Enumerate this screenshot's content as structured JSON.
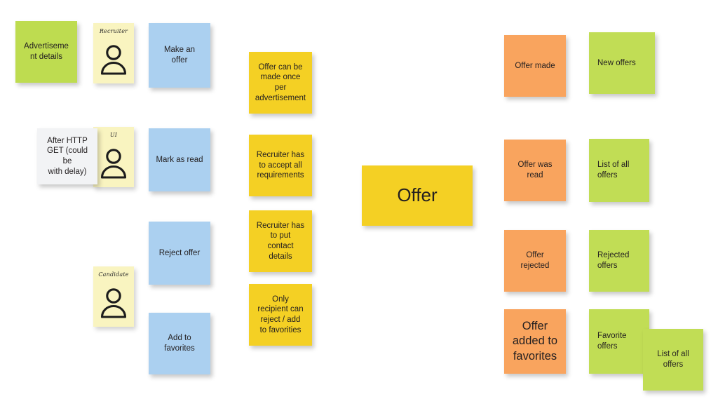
{
  "board": {
    "title": "Offer event storming board",
    "background": "#ffffff",
    "colors": {
      "green": "#c1dd55",
      "blue": "#abd0f0",
      "yellow": "#f4d024",
      "orange": "#f9a45e",
      "pale_yellow": "#f9f4c0",
      "white_note": "#f2f3f5",
      "text": "#231f20"
    }
  },
  "aggregate": {
    "label": "Offer"
  },
  "read_models_left": [
    {
      "label": "Advertiseme\nnt details"
    }
  ],
  "personas": [
    {
      "label": "Recruiter",
      "icon": "person-icon"
    },
    {
      "label": "UI",
      "icon": "person-icon"
    },
    {
      "label": "Candidate",
      "icon": "person-icon"
    }
  ],
  "annotations": [
    {
      "label": "After HTTP\nGET (could be\nwith delay)"
    }
  ],
  "commands": [
    {
      "label": "Make an\noffer"
    },
    {
      "label": "Mark as read"
    },
    {
      "label": "Reject offer"
    },
    {
      "label": "Add to\nfavorites"
    }
  ],
  "policies": [
    {
      "label": "Offer can be\nmade once per\nadvertisement"
    },
    {
      "label": "Recruiter has\nto accept all\nrequirements"
    },
    {
      "label": "Recruiter has\nto put\ncontact\ndetails"
    },
    {
      "label": "Only\nrecipient can\nreject / add\nto favorities"
    }
  ],
  "events": [
    {
      "label": "Offer made"
    },
    {
      "label": "Offer was\nread"
    },
    {
      "label": "Offer\nrejected"
    },
    {
      "label": "Offer\nadded to\nfavorites"
    }
  ],
  "read_models_right": [
    {
      "label": "New offers"
    },
    {
      "label": "List of all\noffers"
    },
    {
      "label": "Rejected\noffers"
    },
    {
      "label": "Favorite\noffers"
    },
    {
      "label": "List of all\noffers"
    }
  ]
}
